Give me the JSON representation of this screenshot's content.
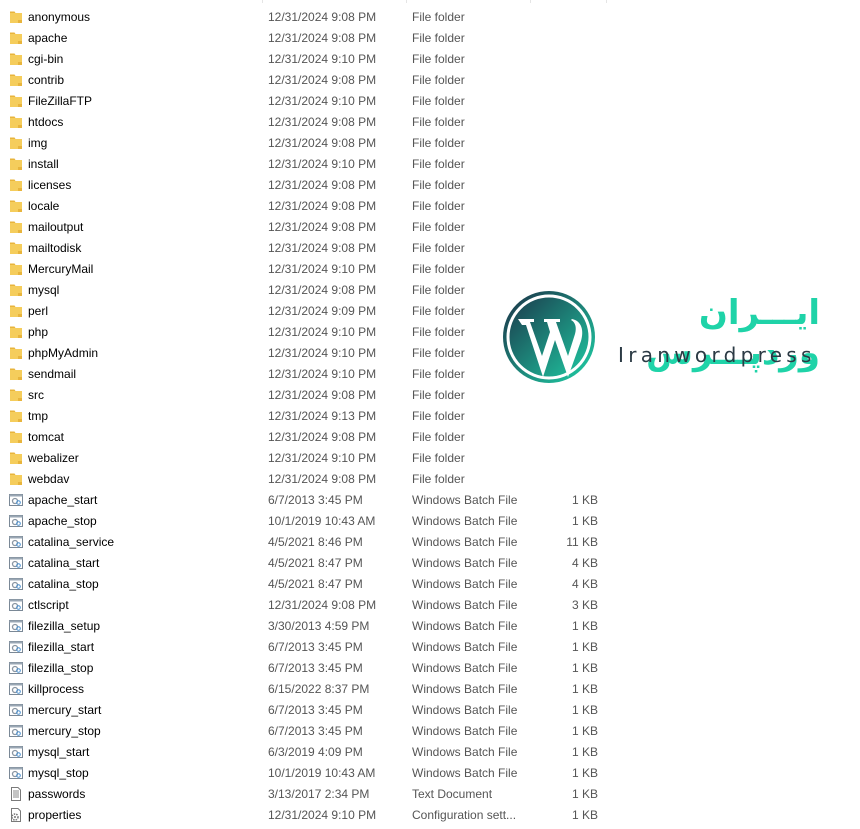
{
  "files": [
    {
      "name": "anonymous",
      "date": "12/31/2024 9:08 PM",
      "type": "File folder",
      "size": "",
      "icon": "folder"
    },
    {
      "name": "apache",
      "date": "12/31/2024 9:08 PM",
      "type": "File folder",
      "size": "",
      "icon": "folder"
    },
    {
      "name": "cgi-bin",
      "date": "12/31/2024 9:10 PM",
      "type": "File folder",
      "size": "",
      "icon": "folder"
    },
    {
      "name": "contrib",
      "date": "12/31/2024 9:08 PM",
      "type": "File folder",
      "size": "",
      "icon": "folder"
    },
    {
      "name": "FileZillaFTP",
      "date": "12/31/2024 9:10 PM",
      "type": "File folder",
      "size": "",
      "icon": "folder"
    },
    {
      "name": "htdocs",
      "date": "12/31/2024 9:08 PM",
      "type": "File folder",
      "size": "",
      "icon": "folder"
    },
    {
      "name": "img",
      "date": "12/31/2024 9:08 PM",
      "type": "File folder",
      "size": "",
      "icon": "folder"
    },
    {
      "name": "install",
      "date": "12/31/2024 9:10 PM",
      "type": "File folder",
      "size": "",
      "icon": "folder"
    },
    {
      "name": "licenses",
      "date": "12/31/2024 9:08 PM",
      "type": "File folder",
      "size": "",
      "icon": "folder"
    },
    {
      "name": "locale",
      "date": "12/31/2024 9:08 PM",
      "type": "File folder",
      "size": "",
      "icon": "folder"
    },
    {
      "name": "mailoutput",
      "date": "12/31/2024 9:08 PM",
      "type": "File folder",
      "size": "",
      "icon": "folder"
    },
    {
      "name": "mailtodisk",
      "date": "12/31/2024 9:08 PM",
      "type": "File folder",
      "size": "",
      "icon": "folder"
    },
    {
      "name": "MercuryMail",
      "date": "12/31/2024 9:10 PM",
      "type": "File folder",
      "size": "",
      "icon": "folder"
    },
    {
      "name": "mysql",
      "date": "12/31/2024 9:08 PM",
      "type": "File folder",
      "size": "",
      "icon": "folder"
    },
    {
      "name": "perl",
      "date": "12/31/2024 9:09 PM",
      "type": "File folder",
      "size": "",
      "icon": "folder"
    },
    {
      "name": "php",
      "date": "12/31/2024 9:10 PM",
      "type": "File folder",
      "size": "",
      "icon": "folder"
    },
    {
      "name": "phpMyAdmin",
      "date": "12/31/2024 9:10 PM",
      "type": "File folder",
      "size": "",
      "icon": "folder"
    },
    {
      "name": "sendmail",
      "date": "12/31/2024 9:10 PM",
      "type": "File folder",
      "size": "",
      "icon": "folder"
    },
    {
      "name": "src",
      "date": "12/31/2024 9:08 PM",
      "type": "File folder",
      "size": "",
      "icon": "folder"
    },
    {
      "name": "tmp",
      "date": "12/31/2024 9:13 PM",
      "type": "File folder",
      "size": "",
      "icon": "folder"
    },
    {
      "name": "tomcat",
      "date": "12/31/2024 9:08 PM",
      "type": "File folder",
      "size": "",
      "icon": "folder"
    },
    {
      "name": "webalizer",
      "date": "12/31/2024 9:10 PM",
      "type": "File folder",
      "size": "",
      "icon": "folder"
    },
    {
      "name": "webdav",
      "date": "12/31/2024 9:08 PM",
      "type": "File folder",
      "size": "",
      "icon": "folder"
    },
    {
      "name": "apache_start",
      "date": "6/7/2013 3:45 PM",
      "type": "Windows Batch File",
      "size": "1 KB",
      "icon": "batch"
    },
    {
      "name": "apache_stop",
      "date": "10/1/2019 10:43 AM",
      "type": "Windows Batch File",
      "size": "1 KB",
      "icon": "batch"
    },
    {
      "name": "catalina_service",
      "date": "4/5/2021 8:46 PM",
      "type": "Windows Batch File",
      "size": "11 KB",
      "icon": "batch"
    },
    {
      "name": "catalina_start",
      "date": "4/5/2021 8:47 PM",
      "type": "Windows Batch File",
      "size": "4 KB",
      "icon": "batch"
    },
    {
      "name": "catalina_stop",
      "date": "4/5/2021 8:47 PM",
      "type": "Windows Batch File",
      "size": "4 KB",
      "icon": "batch"
    },
    {
      "name": "ctlscript",
      "date": "12/31/2024 9:08 PM",
      "type": "Windows Batch File",
      "size": "3 KB",
      "icon": "batch"
    },
    {
      "name": "filezilla_setup",
      "date": "3/30/2013 4:59 PM",
      "type": "Windows Batch File",
      "size": "1 KB",
      "icon": "batch"
    },
    {
      "name": "filezilla_start",
      "date": "6/7/2013 3:45 PM",
      "type": "Windows Batch File",
      "size": "1 KB",
      "icon": "batch"
    },
    {
      "name": "filezilla_stop",
      "date": "6/7/2013 3:45 PM",
      "type": "Windows Batch File",
      "size": "1 KB",
      "icon": "batch"
    },
    {
      "name": "killprocess",
      "date": "6/15/2022 8:37 PM",
      "type": "Windows Batch File",
      "size": "1 KB",
      "icon": "batch"
    },
    {
      "name": "mercury_start",
      "date": "6/7/2013 3:45 PM",
      "type": "Windows Batch File",
      "size": "1 KB",
      "icon": "batch"
    },
    {
      "name": "mercury_stop",
      "date": "6/7/2013 3:45 PM",
      "type": "Windows Batch File",
      "size": "1 KB",
      "icon": "batch"
    },
    {
      "name": "mysql_start",
      "date": "6/3/2019 4:09 PM",
      "type": "Windows Batch File",
      "size": "1 KB",
      "icon": "batch"
    },
    {
      "name": "mysql_stop",
      "date": "10/1/2019 10:43 AM",
      "type": "Windows Batch File",
      "size": "1 KB",
      "icon": "batch"
    },
    {
      "name": "passwords",
      "date": "3/13/2017 2:34 PM",
      "type": "Text Document",
      "size": "1 KB",
      "icon": "text"
    },
    {
      "name": "properties",
      "date": "12/31/2024 9:10 PM",
      "type": "Configuration sett...",
      "size": "1 KB",
      "icon": "config"
    }
  ],
  "watermark": {
    "persian": "ایـــران وردپـــرس",
    "latin": "Iranwordpress"
  },
  "colors": {
    "folder": "#f5cd5c",
    "brand_teal": "#1fd3a8",
    "brand_dark": "#1d3a4a"
  }
}
